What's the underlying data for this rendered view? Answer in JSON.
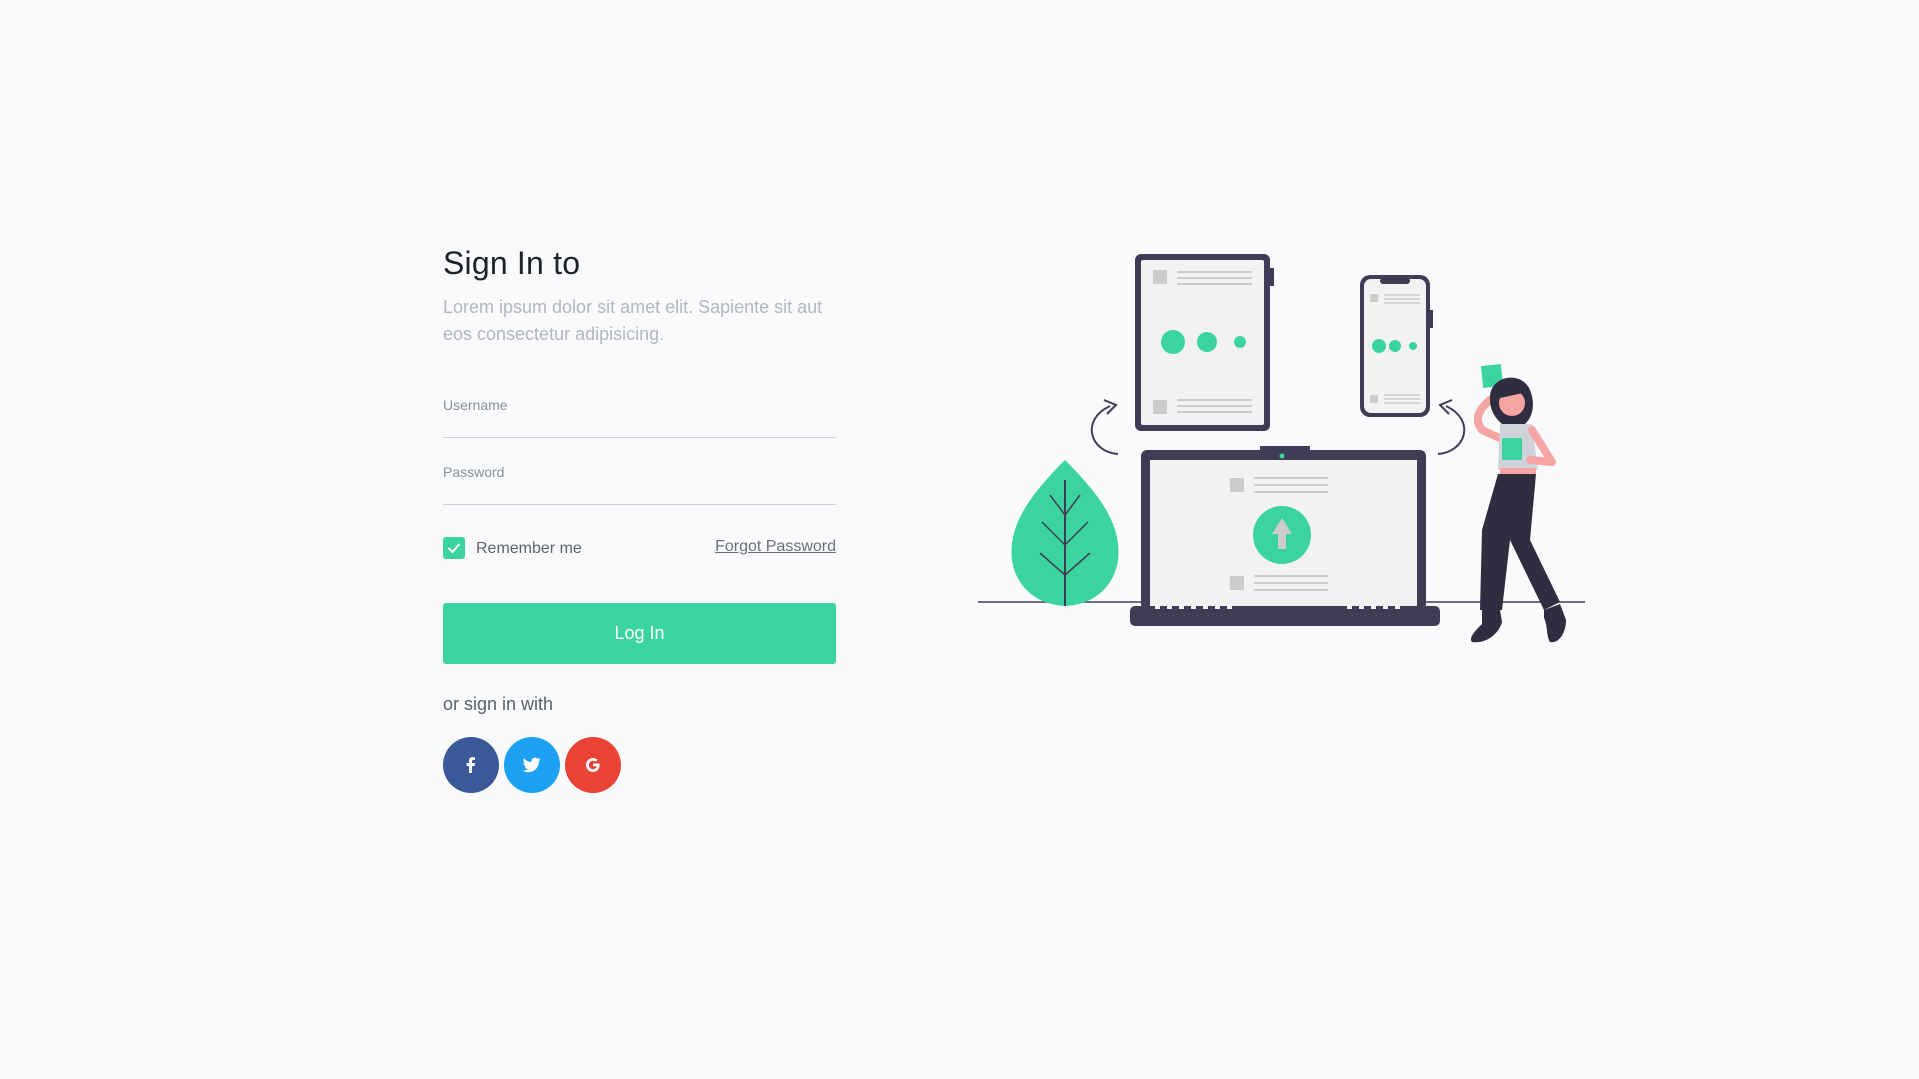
{
  "colors": {
    "accent": "#3bd49f",
    "background": "#f8fafc",
    "facebook": "#3b5998",
    "twitter": "#1da1f2",
    "google": "#ea4335",
    "illustration_dark": "#3f3d56"
  },
  "signin": {
    "title": "Sign In to",
    "subtitle": "Lorem ipsum dolor sit amet elit. Sapiente sit aut eos consectetur adipisicing."
  },
  "form": {
    "username_label": "Username",
    "username_value": "",
    "password_label": "Password",
    "password_value": "",
    "remember_label": "Remember me",
    "remember_checked": true,
    "forgot_label": "Forgot Password",
    "login_label": "Log In"
  },
  "social": {
    "prompt": "or sign in with",
    "buttons": [
      {
        "name": "facebook",
        "icon": "facebook-icon",
        "glyph": "f"
      },
      {
        "name": "twitter",
        "icon": "twitter-icon",
        "glyph": ""
      },
      {
        "name": "google",
        "icon": "google-icon",
        "glyph": "G"
      }
    ]
  },
  "illustration": {
    "icon": "devices-upload-illustration"
  }
}
